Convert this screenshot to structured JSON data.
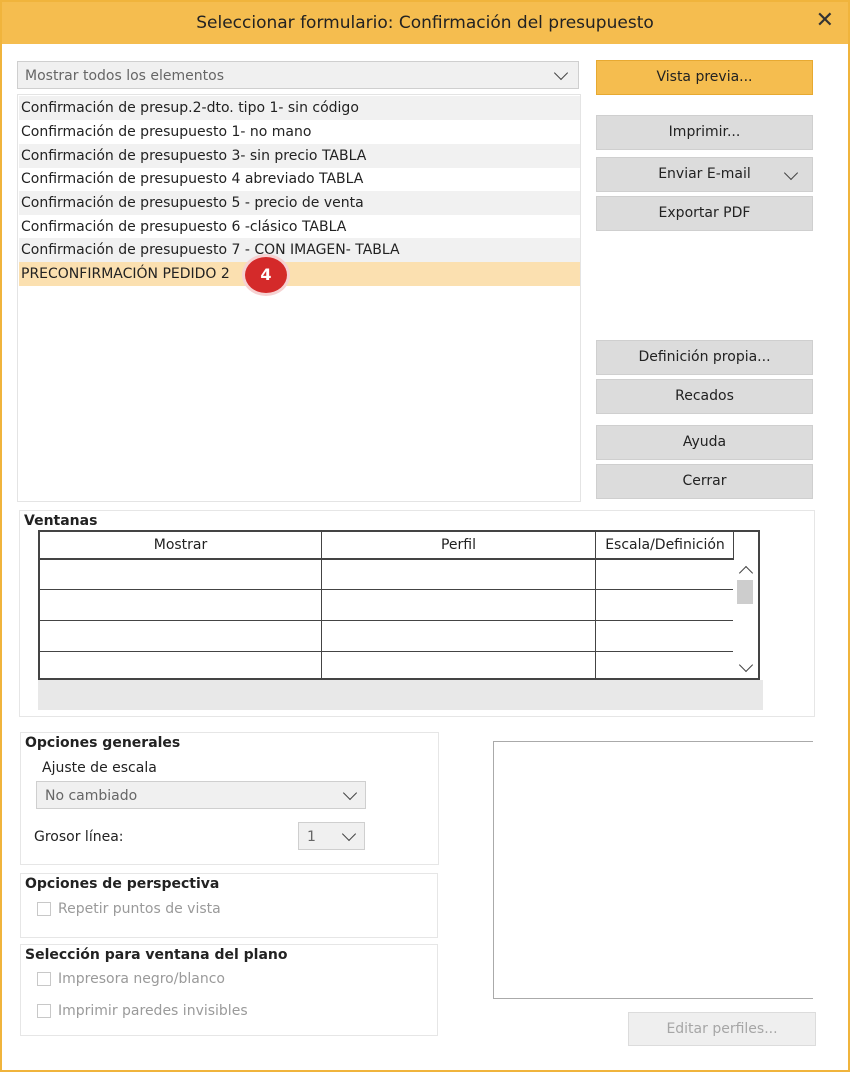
{
  "window": {
    "title": "Seleccionar formulario: Confirmación del presupuesto",
    "close_icon": "close-icon"
  },
  "filter": {
    "value": "Mostrar todos los elementos"
  },
  "forms_list": {
    "items": [
      "Confirmación de presup.2-dto. tipo 1- sin código",
      "Confirmación de presupuesto 1- no mano",
      "Confirmación de presupuesto 3- sin precio TABLA",
      "Confirmación de presupuesto 4  abreviado TABLA",
      "Confirmación de presupuesto 5 - precio de venta",
      "Confirmación de presupuesto 6 -clásico TABLA",
      "Confirmación de presupuesto 7 - CON IMAGEN- TABLA",
      "PRECONFIRMACIÓN PEDIDO 2"
    ],
    "selected_index": 7,
    "step_badge": "4"
  },
  "buttons": {
    "preview": "Vista previa...",
    "print": "Imprimir...",
    "email": "Enviar E-mail",
    "export_pdf": "Exportar PDF",
    "own_definition": "Definición propia...",
    "messages": "Recados",
    "help": "Ayuda",
    "close": "Cerrar",
    "edit_profiles": "Editar perfiles..."
  },
  "windows_section": {
    "title": "Ventanas",
    "columns": [
      "Mostrar",
      "Perfil",
      "Escala/Definición"
    ]
  },
  "general_options": {
    "title": "Opciones generales",
    "scale_label": "Ajuste de escala",
    "scale_value": "No cambiado",
    "line_label": "Grosor línea:",
    "line_value": "1"
  },
  "perspective_options": {
    "title": "Opciones de perspectiva",
    "repeat_viewpoints": "Repetir puntos de vista"
  },
  "plan_selection": {
    "title": "Selección para ventana del plano",
    "bw_printer": "Impresora negro/blanco",
    "print_invisible_walls": "Imprimir paredes invisibles"
  },
  "colors": {
    "accent": "#f5bd4f",
    "selection": "#fbe0b0",
    "badge": "#d42a2a"
  }
}
